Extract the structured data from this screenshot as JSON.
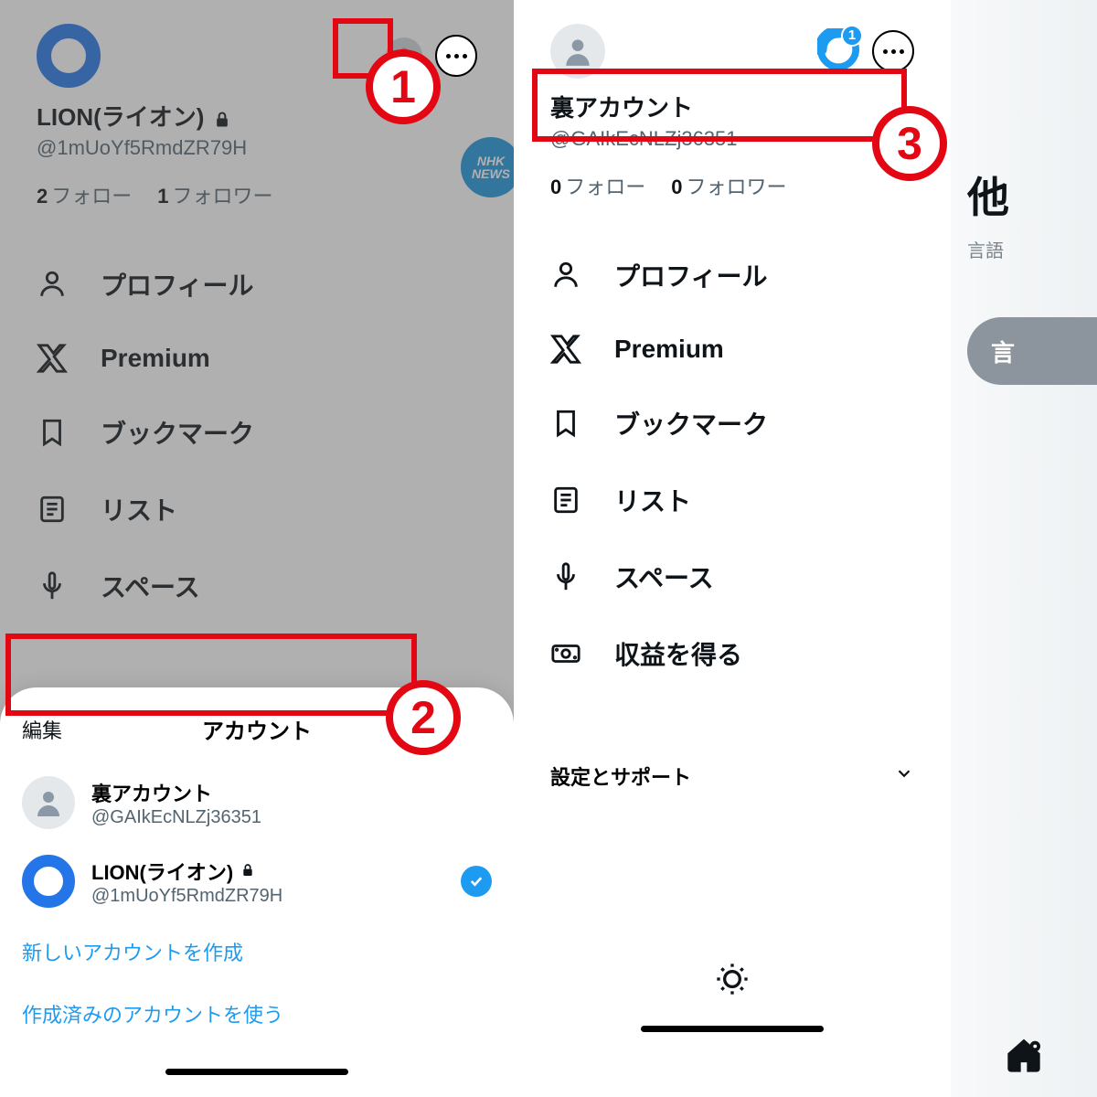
{
  "annotations": {
    "step1": "1",
    "step2": "2",
    "step3": "3"
  },
  "left_panel": {
    "display_name": "LION(ライオン)",
    "handle": "@1mUoYf5RmdZR79H",
    "following_count": "2",
    "following_label": "フォロー",
    "followers_count": "1",
    "followers_label": "フォロワー",
    "nhk_line1": "NHK",
    "nhk_line2": "NEWS",
    "menu": [
      {
        "label": "プロフィール",
        "icon": "person"
      },
      {
        "label": "Premium",
        "icon": "x-logo"
      },
      {
        "label": "ブックマーク",
        "icon": "bookmark"
      },
      {
        "label": "リスト",
        "icon": "list"
      },
      {
        "label": "スペース",
        "icon": "spaces"
      }
    ]
  },
  "sheet": {
    "edit": "編集",
    "title": "アカウント",
    "accounts": [
      {
        "name": "裏アカウント",
        "handle": "@GAIkEcNLZj36351",
        "avatar": "grey",
        "active": false
      },
      {
        "name": "LION(ライオン)",
        "handle": "@1mUoYf5RmdZR79H",
        "avatar": "o",
        "active": true,
        "locked": true
      }
    ],
    "create_link": "新しいアカウントを作成",
    "existing_link": "作成済みのアカウントを使う"
  },
  "right_panel": {
    "display_name": "裏アカウント",
    "handle": "@GAIkEcNLZj36351",
    "following_count": "0",
    "following_label": "フォロー",
    "followers_count": "0",
    "followers_label": "フォロワー",
    "notification_badge": "1",
    "menu": [
      {
        "label": "プロフィール",
        "icon": "person"
      },
      {
        "label": "Premium",
        "icon": "x-logo"
      },
      {
        "label": "ブックマーク",
        "icon": "bookmark"
      },
      {
        "label": "リスト",
        "icon": "list"
      },
      {
        "label": "スペース",
        "icon": "spaces"
      },
      {
        "label": "収益を得る",
        "icon": "money"
      }
    ],
    "settings_label": "設定とサポート"
  },
  "edge": {
    "title": "他",
    "subtitle": "言語",
    "pill": "言"
  }
}
